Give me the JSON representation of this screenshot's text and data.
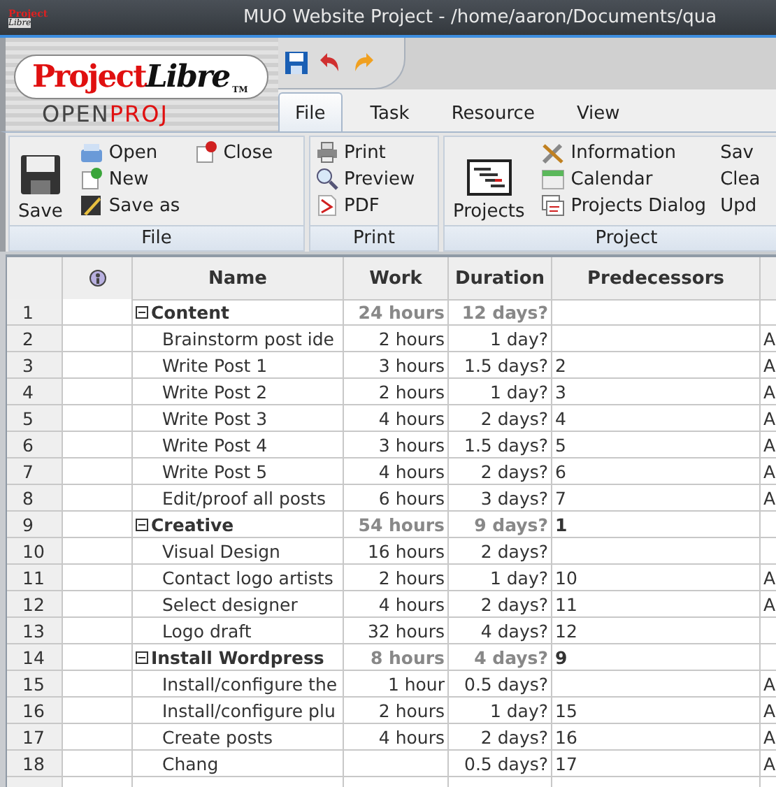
{
  "window": {
    "title": "MUO Website Project - /home/aaron/Documents/qua",
    "app_icon": {
      "top": "Project",
      "bottom": "Libre"
    }
  },
  "logo": {
    "first": "Project",
    "second": "Libre",
    "tm": "TM",
    "open": "OPEN",
    "proj": "PROJ"
  },
  "quick_toolbar": [
    {
      "kind": "save"
    },
    {
      "kind": "undo"
    },
    {
      "kind": "redo"
    }
  ],
  "tabs": [
    {
      "label": "File",
      "selected": true
    },
    {
      "label": "Task",
      "selected": false
    },
    {
      "label": "Resource",
      "selected": false
    },
    {
      "label": "View",
      "selected": false
    }
  ],
  "ribbon": {
    "groups": [
      {
        "label": "File",
        "big": {
          "label": "Save"
        },
        "columns": [
          [
            {
              "label": "Open"
            },
            {
              "label": "New"
            },
            {
              "label": "Save as"
            }
          ],
          [
            {
              "label": "Close"
            }
          ]
        ]
      },
      {
        "label": "Print",
        "columns": [
          [
            {
              "label": "Print"
            },
            {
              "label": "Preview"
            },
            {
              "label": "PDF"
            }
          ]
        ]
      },
      {
        "label": "Project",
        "big": {
          "label": "Projects"
        },
        "columns": [
          [
            {
              "label": "Information"
            },
            {
              "label": "Calendar"
            },
            {
              "label": "Projects Dialog"
            }
          ],
          [
            {
              "label": "Sav"
            },
            {
              "label": "Clea"
            },
            {
              "label": "Upd"
            }
          ]
        ]
      }
    ]
  },
  "table": {
    "columns": [
      "Name",
      "Work",
      "Duration",
      "Predecessors"
    ],
    "rows": [
      {
        "num": "1",
        "kind": "summary",
        "expanded": true,
        "name": "Content",
        "work": "24 hours",
        "duration": "12 days?",
        "pred": "",
        "col7": ""
      },
      {
        "num": "2",
        "kind": "task",
        "name": "Brainstorm post ide",
        "work": "2 hours",
        "duration": "1 day?",
        "pred": "",
        "col7": "A"
      },
      {
        "num": "3",
        "kind": "task",
        "name": "Write Post 1",
        "work": "3 hours",
        "duration": "1.5 days?",
        "pred": "2",
        "col7": "A"
      },
      {
        "num": "4",
        "kind": "task",
        "name": "Write Post 2",
        "work": "2 hours",
        "duration": "1 day?",
        "pred": "3",
        "col7": "A"
      },
      {
        "num": "5",
        "kind": "task",
        "name": "Write Post 3",
        "work": "4 hours",
        "duration": "2 days?",
        "pred": "4",
        "col7": "A"
      },
      {
        "num": "6",
        "kind": "task",
        "name": "Write Post 4",
        "work": "3 hours",
        "duration": "1.5 days?",
        "pred": "5",
        "col7": "A"
      },
      {
        "num": "7",
        "kind": "task",
        "name": "Write Post 5",
        "work": "4 hours",
        "duration": "2 days?",
        "pred": "6",
        "col7": "A"
      },
      {
        "num": "8",
        "kind": "task",
        "name": "Edit/proof all posts",
        "work": "6 hours",
        "duration": "3 days?",
        "pred": "7",
        "col7": "A"
      },
      {
        "num": "9",
        "kind": "summary",
        "expanded": true,
        "name": "Creative",
        "work": "54 hours",
        "duration": "9 days?",
        "pred": "1",
        "col7": ""
      },
      {
        "num": "10",
        "kind": "task",
        "name": "Visual Design",
        "work": "16 hours",
        "duration": "2 days?",
        "pred": "",
        "col7": ""
      },
      {
        "num": "11",
        "kind": "task",
        "name": "Contact logo artists",
        "work": "2 hours",
        "duration": "1 day?",
        "pred": "10",
        "col7": "A"
      },
      {
        "num": "12",
        "kind": "task",
        "name": "Select designer",
        "work": "4 hours",
        "duration": "2 days?",
        "pred": "11",
        "col7": "A"
      },
      {
        "num": "13",
        "kind": "task",
        "name": "Logo draft",
        "work": "32 hours",
        "duration": "4 days?",
        "pred": "12",
        "col7": ""
      },
      {
        "num": "14",
        "kind": "summary",
        "expanded": true,
        "name": "Install Wordpress",
        "work": "8 hours",
        "duration": "4 days?",
        "pred": "9",
        "col7": ""
      },
      {
        "num": "15",
        "kind": "task",
        "name": "Install/configure the",
        "work": "1 hour",
        "duration": "0.5 days?",
        "pred": "",
        "col7": "A"
      },
      {
        "num": "16",
        "kind": "task",
        "name": "Install/configure plu",
        "work": "2 hours",
        "duration": "1 day?",
        "pred": "15",
        "col7": "A"
      },
      {
        "num": "17",
        "kind": "task",
        "name": "Create posts",
        "work": "4 hours",
        "duration": "2 days?",
        "pred": "16",
        "col7": "A"
      },
      {
        "num": "18",
        "kind": "task",
        "name": "Chang",
        "work": "",
        "duration": "0.5 days?",
        "pred": "17",
        "col7": "A"
      }
    ]
  }
}
